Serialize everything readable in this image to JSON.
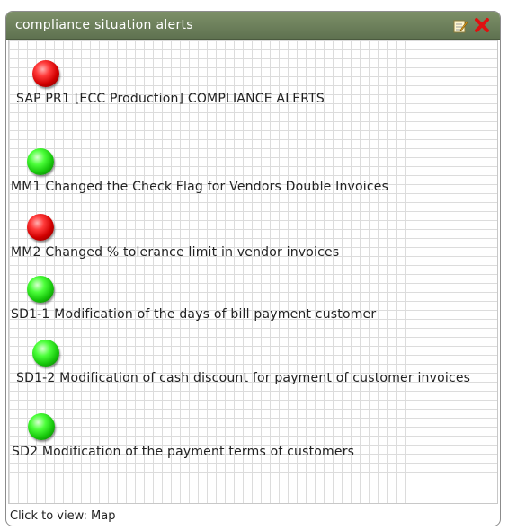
{
  "widget": {
    "title": "compliance situation alerts",
    "edit_icon": "edit-icon",
    "close_icon": "close-icon"
  },
  "alerts": [
    {
      "status": "red",
      "label": "SAP PR1 [ECC Production] COMPLIANCE ALERTS"
    },
    {
      "status": "green",
      "label": "MM1 Changed the Check Flag for Vendors Double Invoices"
    },
    {
      "status": "red",
      "label": "MM2 Changed % tolerance limit in vendor invoices"
    },
    {
      "status": "green",
      "label": "SD1-1 Modification of the days of bill payment customer"
    },
    {
      "status": "green",
      "label": "SD1-2 Modification of cash discount for payment of customer invoices"
    },
    {
      "status": "green",
      "label": "SD2 Modification of the payment terms of customers"
    }
  ],
  "footer": {
    "prefix": "Click to view: ",
    "link": "Map"
  },
  "colors": {
    "titlebar": "#6b7f5a",
    "red_led": "#e00000",
    "green_led": "#22d012"
  }
}
